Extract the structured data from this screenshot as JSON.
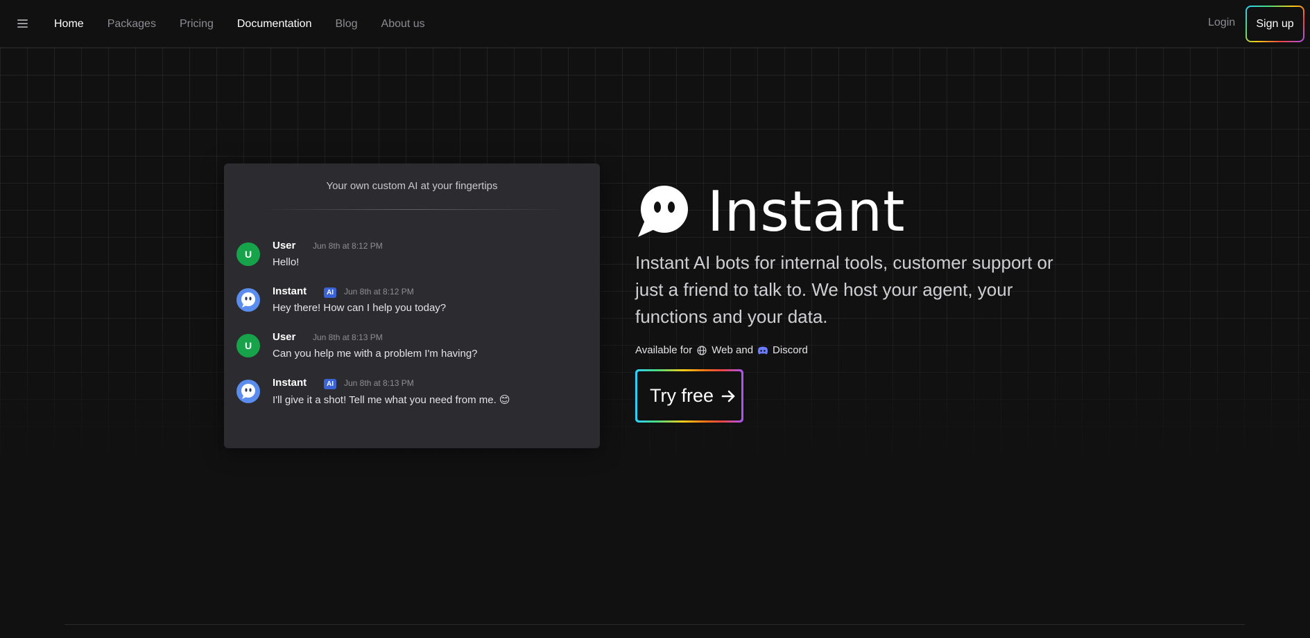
{
  "header": {
    "menu_icon": "hamburger-menu-icon",
    "nav": [
      {
        "label": "Home",
        "active": true
      },
      {
        "label": "Packages",
        "active": false
      },
      {
        "label": "Pricing",
        "active": false
      },
      {
        "label": "Documentation",
        "active": false
      },
      {
        "label": "Blog",
        "active": false
      },
      {
        "label": "About us",
        "active": false
      }
    ],
    "login_label": "Login",
    "signup_label": "Sign up"
  },
  "chat": {
    "title": "Your own custom AI at your fingertips",
    "messages": [
      {
        "author": "User",
        "avatar": "U",
        "is_bot": false,
        "time": "Jun 8th at 8:12 PM",
        "text": "Hello!"
      },
      {
        "author": "Instant",
        "avatar": "bot-face-icon",
        "is_bot": true,
        "badge": "AI",
        "time": "Jun 8th at 8:12 PM",
        "text": "Hey there! How can I help you today?"
      },
      {
        "author": "User",
        "avatar": "U",
        "is_bot": false,
        "time": "Jun 8th at 8:13 PM",
        "text": "Can you help me with a problem I'm having?"
      },
      {
        "author": "Instant",
        "avatar": "bot-face-icon",
        "is_bot": true,
        "badge": "AI",
        "time": "Jun 8th at 8:13 PM",
        "text": "I'll give it a shot! Tell me what you need from me. 😊"
      }
    ]
  },
  "hero": {
    "brand_name": "Instant",
    "tagline": "Instant AI bots for internal tools, customer support or just a friend to talk to. We host your agent, your functions and your data.",
    "available_prefix": "Available for",
    "platform_web": "Web and",
    "platform_discord": "Discord",
    "cta_label": "Try free"
  },
  "colors": {
    "background": "#111112",
    "card": "#2c2c30",
    "user_avatar": "#16a34a",
    "bot_avatar": "#5b8def",
    "ai_badge": "#3b63d6"
  }
}
